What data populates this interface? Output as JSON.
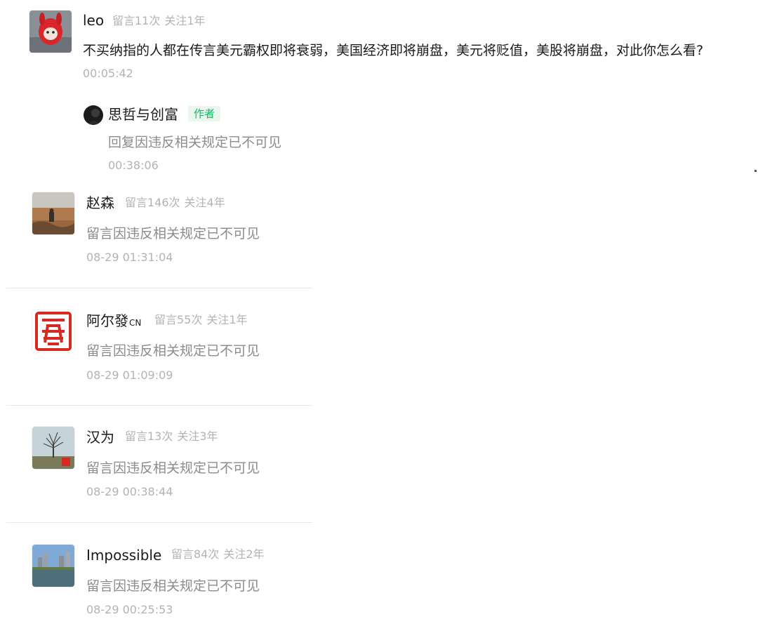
{
  "comments": [
    {
      "user": "leo",
      "msg_count": "留言11次",
      "follow": "关注1年",
      "content": "不买纳指的人都在传言美元霸权即将衰弱，美国经济即将崩盘，美元将贬值，美股将崩盘，对此你怎么看?",
      "time": "00:05:42",
      "reply": {
        "user": "思哲与创富",
        "badge": "作者",
        "content": "回复因违反相关规定已不可见",
        "time": "00:38:06"
      }
    },
    {
      "user": "赵森",
      "msg_count": "留言146次",
      "follow": "关注4年",
      "content": "留言因违反相关规定已不可见",
      "time": "08-29 01:31:04"
    },
    {
      "user": "阿尔發",
      "user_suffix": "CN",
      "msg_count": "留言55次",
      "follow": "关注1年",
      "content": "留言因违反相关规定已不可见",
      "time": "08-29 01:09:09"
    },
    {
      "user": "汉为",
      "msg_count": "留言13次",
      "follow": "关注3年",
      "content": "留言因违反相关规定已不可见",
      "time": "08-29 00:38:44"
    },
    {
      "user": "Impossible",
      "msg_count": "留言84次",
      "follow": "关注2年",
      "content": "留言因违反相关规定已不可见",
      "time": "08-29 00:25:53"
    }
  ],
  "colors": {
    "author_badge_text": "#07c160",
    "author_badge_bg": "#eaf7ef",
    "meta_gray": "#b3b3b3",
    "content_gray": "#8c8c8c"
  },
  "icons": {
    "avatar_leo": "red-hooded-plush-toy",
    "avatar_reply": "dark-round-portrait",
    "avatar_zhaosen": "desert-landscape-photo",
    "avatar_aerfa": "red-seal-stamp",
    "avatar_hanwei": "lone-tree-photo",
    "avatar_impossible": "city-lake-photo"
  }
}
